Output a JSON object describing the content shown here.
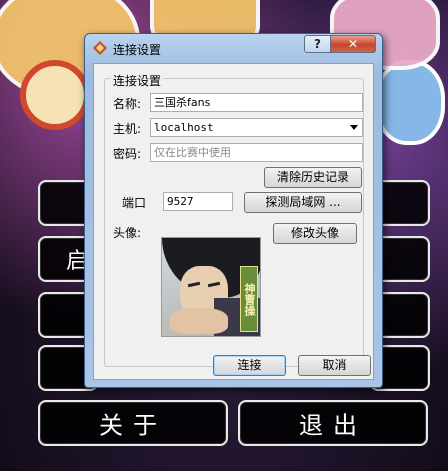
{
  "background_menu": {
    "buttons": [
      {
        "label": ""
      },
      {
        "label": ""
      },
      {
        "label": ""
      },
      {
        "label": ""
      },
      {
        "label": "关于"
      },
      {
        "label": "退出"
      }
    ],
    "partial_glyphs": {
      "left_row2": "启"
    }
  },
  "dialog": {
    "title": "连接设置",
    "help_button": "?",
    "close_button": "✕",
    "group_title": "连接设置",
    "name_label": "名称:",
    "name_value": "三国杀fans",
    "host_label": "主机:",
    "host_value": "localhost",
    "password_label": "密码:",
    "password_placeholder": "仅在比赛中使用",
    "clear_history_button": "清除历史记录",
    "port_label": "端口",
    "port_value": "9527",
    "detect_lan_button": "探测局域网 ...",
    "avatar_label": "头像:",
    "change_avatar_button": "修改头像",
    "avatar_nameplate": "神曹操",
    "connect_button": "连接",
    "cancel_button": "取消"
  },
  "colors": {
    "title_bar": "#b9d3ee",
    "close_button": "#c9452b",
    "client_bg": "#f0f0f0"
  },
  "icons": [
    "app-diamond-icon",
    "dropdown-arrow-icon"
  ]
}
